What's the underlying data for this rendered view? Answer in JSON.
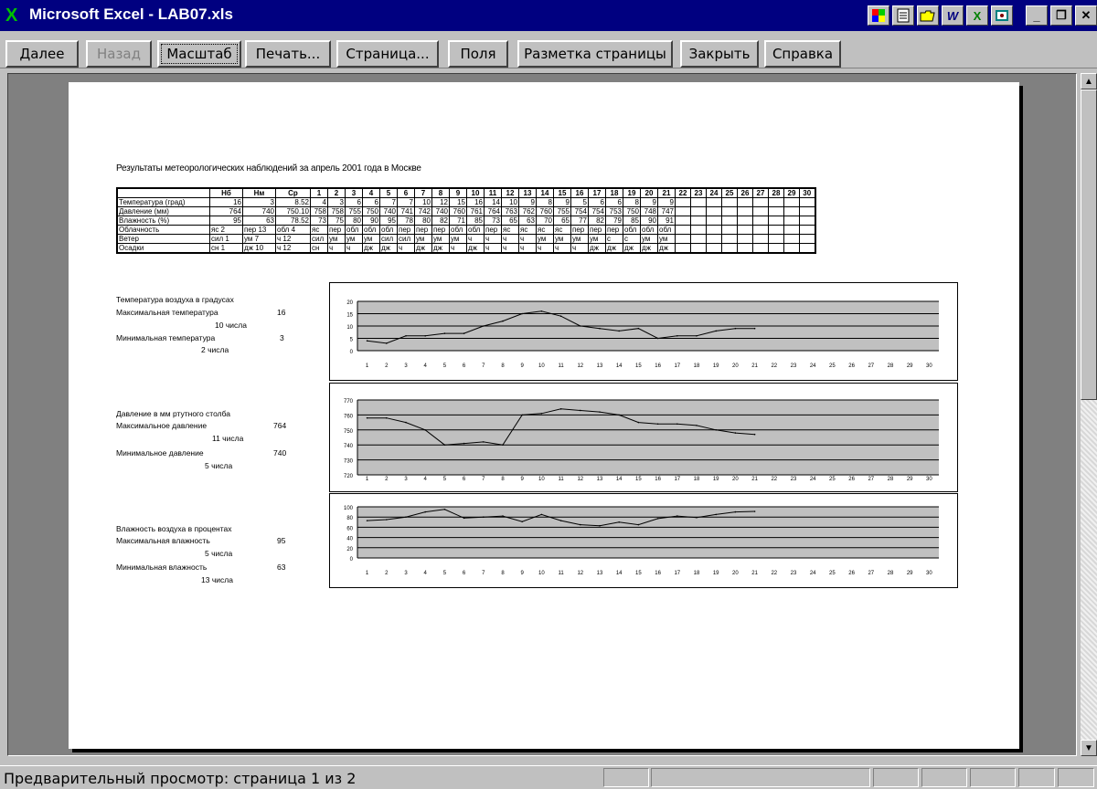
{
  "window": {
    "title": "Microsoft Excel - LAB07.xls",
    "app_icon": "X"
  },
  "toolbar_icons": [
    "color-palette-icon",
    "document-icon",
    "open-folder-icon",
    "word-icon",
    "excel-icon",
    "access-icon",
    "minimize-icon",
    "restore-icon",
    "close-icon"
  ],
  "toolbar": {
    "next": "Далее",
    "back": "Назад",
    "zoom": "Масштаб",
    "print": "Печать...",
    "setup": "Страница...",
    "margins": "Поля",
    "layout": "Разметка страницы",
    "close": "Закрыть",
    "help": "Справка"
  },
  "status": {
    "text": "Предварительный просмотр: страница 1 из 2"
  },
  "sheet": {
    "title": "Результаты метеорологических наблюдений за апрель 2001 года в Москве",
    "header": [
      "",
      "Нб",
      "Нм",
      "Ср",
      "1",
      "2",
      "3",
      "4",
      "5",
      "6",
      "7",
      "8",
      "9",
      "10",
      "11",
      "12",
      "13",
      "14",
      "15",
      "16",
      "17",
      "18",
      "19",
      "20",
      "21",
      "22",
      "23",
      "24",
      "25",
      "26",
      "27",
      "28",
      "29",
      "30"
    ],
    "rows": [
      [
        "Температура (град)",
        "16",
        "3",
        "8.52",
        "4",
        "3",
        "6",
        "6",
        "7",
        "7",
        "10",
        "12",
        "15",
        "16",
        "14",
        "10",
        "9",
        "8",
        "9",
        "5",
        "6",
        "6",
        "8",
        "9",
        "9",
        "",
        "",
        "",
        "",
        "",
        "",
        "",
        "",
        ""
      ],
      [
        "Давление (мм)",
        "764",
        "740",
        "750.10",
        "758",
        "758",
        "755",
        "750",
        "740",
        "741",
        "742",
        "740",
        "760",
        "761",
        "764",
        "763",
        "762",
        "760",
        "755",
        "754",
        "754",
        "753",
        "750",
        "748",
        "747",
        "",
        "",
        "",
        "",
        "",
        "",
        "",
        "",
        ""
      ],
      [
        "Влажность (%)",
        "95",
        "63",
        "78.52",
        "73",
        "75",
        "80",
        "90",
        "95",
        "78",
        "80",
        "82",
        "71",
        "85",
        "73",
        "65",
        "63",
        "70",
        "65",
        "77",
        "82",
        "79",
        "85",
        "90",
        "91",
        "",
        "",
        "",
        "",
        "",
        "",
        "",
        "",
        ""
      ],
      [
        "Облачность",
        "яс 2",
        "пер 13",
        "обл 4",
        "яс",
        "пер",
        "обл",
        "обл",
        "обл",
        "пер",
        "пер",
        "пер",
        "обл",
        "обл",
        "пер",
        "яс",
        "яс",
        "яс",
        "яс",
        "пер",
        "пер",
        "пер",
        "обл",
        "обл",
        "обл",
        "",
        "",
        "",
        "",
        "",
        "",
        "",
        "",
        ""
      ],
      [
        "Ветер",
        "сил 1",
        "ум 7",
        "ч 12",
        "сил",
        "ум",
        "ум",
        "ум",
        "сил",
        "сил",
        "ум",
        "ум",
        "ум",
        "ч",
        "ч",
        "ч",
        "ч",
        "ум",
        "ум",
        "ум",
        "ум",
        "с",
        "с",
        "ум",
        "ум",
        "",
        "",
        "",
        "",
        "",
        "",
        "",
        "",
        ""
      ],
      [
        "Осадки",
        "сн 1",
        "дж 10",
        "ч 12",
        "сн",
        "ч",
        "ч",
        "дж",
        "дж",
        "ч",
        "дж",
        "дж",
        "ч",
        "дж",
        "ч",
        "ч",
        "ч",
        "ч",
        "ч",
        "ч",
        "дж",
        "дж",
        "дж",
        "дж",
        "дж",
        "",
        "",
        "",
        "",
        "",
        "",
        "",
        "",
        ""
      ]
    ]
  },
  "side": {
    "temp": {
      "title": "Температура воздуха в градусах",
      "max_label": "Максимальная температура",
      "max_value": "16",
      "max_day": "10 числа",
      "min_label": "Минимальная температура",
      "min_value": "3",
      "min_day": "2 числа"
    },
    "pressure": {
      "title": "Давление в мм ртутного столба",
      "max_label": "Максимальное давление",
      "max_value": "764",
      "max_day": "11 числа",
      "min_label": "Минимальное давление",
      "min_value": "740",
      "min_day": "5 числа"
    },
    "humidity": {
      "title": "Влажность воздуха в процентах",
      "max_label": "Максимальная влажность",
      "max_value": "95",
      "max_day": "5 числа",
      "min_label": "Минимальная влажность",
      "min_value": "63",
      "min_day": "13 числа"
    }
  },
  "chart_data": [
    {
      "type": "line",
      "categories": [
        "1",
        "2",
        "3",
        "4",
        "5",
        "6",
        "7",
        "8",
        "9",
        "10",
        "11",
        "12",
        "13",
        "14",
        "15",
        "16",
        "17",
        "18",
        "19",
        "20",
        "21",
        "22",
        "23",
        "24",
        "25",
        "26",
        "27",
        "28",
        "29",
        "30"
      ],
      "values": [
        4,
        3,
        6,
        6,
        7,
        7,
        10,
        12,
        15,
        16,
        14,
        10,
        9,
        8,
        9,
        5,
        6,
        6,
        8,
        9,
        9
      ],
      "ylim": [
        0,
        20
      ],
      "yticks": [
        "0",
        "5",
        "10",
        "15",
        "20"
      ],
      "grid": true
    },
    {
      "type": "line",
      "categories": [
        "1",
        "2",
        "3",
        "4",
        "5",
        "6",
        "7",
        "8",
        "9",
        "10",
        "11",
        "12",
        "13",
        "14",
        "15",
        "16",
        "17",
        "18",
        "19",
        "20",
        "21",
        "22",
        "23",
        "24",
        "25",
        "26",
        "27",
        "28",
        "29",
        "30"
      ],
      "values": [
        758,
        758,
        755,
        750,
        740,
        741,
        742,
        740,
        760,
        761,
        764,
        763,
        762,
        760,
        755,
        754,
        754,
        753,
        750,
        748,
        747
      ],
      "ylim": [
        720,
        770
      ],
      "yticks": [
        "720",
        "730",
        "740",
        "750",
        "760",
        "770"
      ],
      "grid": true
    },
    {
      "type": "line",
      "categories": [
        "1",
        "2",
        "3",
        "4",
        "5",
        "6",
        "7",
        "8",
        "9",
        "10",
        "11",
        "12",
        "13",
        "14",
        "15",
        "16",
        "17",
        "18",
        "19",
        "20",
        "21",
        "22",
        "23",
        "24",
        "25",
        "26",
        "27",
        "28",
        "29",
        "30"
      ],
      "values": [
        73,
        75,
        80,
        90,
        95,
        78,
        80,
        82,
        71,
        85,
        73,
        65,
        63,
        70,
        65,
        77,
        82,
        79,
        85,
        90,
        91
      ],
      "ylim": [
        0,
        100
      ],
      "yticks": [
        "0",
        "20",
        "40",
        "60",
        "80",
        "100"
      ],
      "grid": true
    }
  ]
}
